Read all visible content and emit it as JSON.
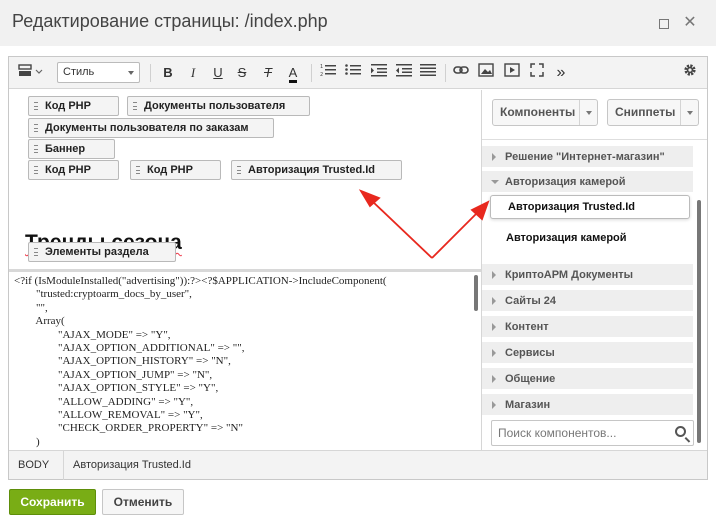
{
  "window": {
    "title": "Редактирование страницы: /index.php"
  },
  "toolbar": {
    "style_select": "Стиль",
    "bold": "B",
    "italic": "I",
    "underline": "U",
    "strike": "S",
    "clear_format": "T",
    "font_color": "A",
    "more": "»"
  },
  "visual": {
    "components": [
      {
        "label": "Код PHP"
      },
      {
        "label": "Документы пользователя"
      },
      {
        "label": "Документы пользователя по заказам"
      },
      {
        "label": "Баннер"
      },
      {
        "label": "Код PHP"
      },
      {
        "label": "Код PHP"
      },
      {
        "label": "Авторизация Trusted.Id"
      }
    ],
    "heading": "Тренды сезона",
    "section_component": "Элементы раздела"
  },
  "code": {
    "lines": [
      "<?if (IsModuleInstalled(\"advertising\")):?><?$APPLICATION->IncludeComponent(",
      "        \"trusted:cryptoarm_docs_by_user\",",
      "        \"\",",
      "        Array(",
      "                \"AJAX_MODE\" => \"Y\",",
      "                \"AJAX_OPTION_ADDITIONAL\" => \"\",",
      "                \"AJAX_OPTION_HISTORY\" => \"N\",",
      "                \"AJAX_OPTION_JUMP\" => \"N\",",
      "                \"AJAX_OPTION_STYLE\" => \"Y\",",
      "                \"ALLOW_ADDING\" => \"Y\",",
      "                \"ALLOW_REMOVAL\" => \"Y\",",
      "                \"CHECK_ORDER_PROPERTY\" => \"N\"",
      "        )"
    ]
  },
  "sidebar": {
    "components_button": "Компоненты",
    "snippets_button": "Сниппеты",
    "categories": [
      {
        "label": "Решение \"Интернет-магазин\"",
        "open": false
      },
      {
        "label": "Авторизация камерой",
        "open": true
      },
      {
        "label": "КриптоАРМ Документы",
        "open": false
      },
      {
        "label": "Сайты 24",
        "open": false
      },
      {
        "label": "Контент",
        "open": false
      },
      {
        "label": "Сервисы",
        "open": false
      },
      {
        "label": "Общение",
        "open": false
      },
      {
        "label": "Магазин",
        "open": false
      }
    ],
    "items": [
      {
        "label": "Авторизация Trusted.Id",
        "selected": true
      },
      {
        "label": "Авторизация камерой",
        "selected": false
      }
    ],
    "search_placeholder": "Поиск компонентов..."
  },
  "statusbar": {
    "crumbs": [
      "BODY",
      "Авторизация Trusted.Id"
    ]
  },
  "actions": {
    "save": "Сохранить",
    "cancel": "Отменить"
  },
  "colors": {
    "save_green": "#79ad15",
    "arrow_red": "#e8281e"
  }
}
